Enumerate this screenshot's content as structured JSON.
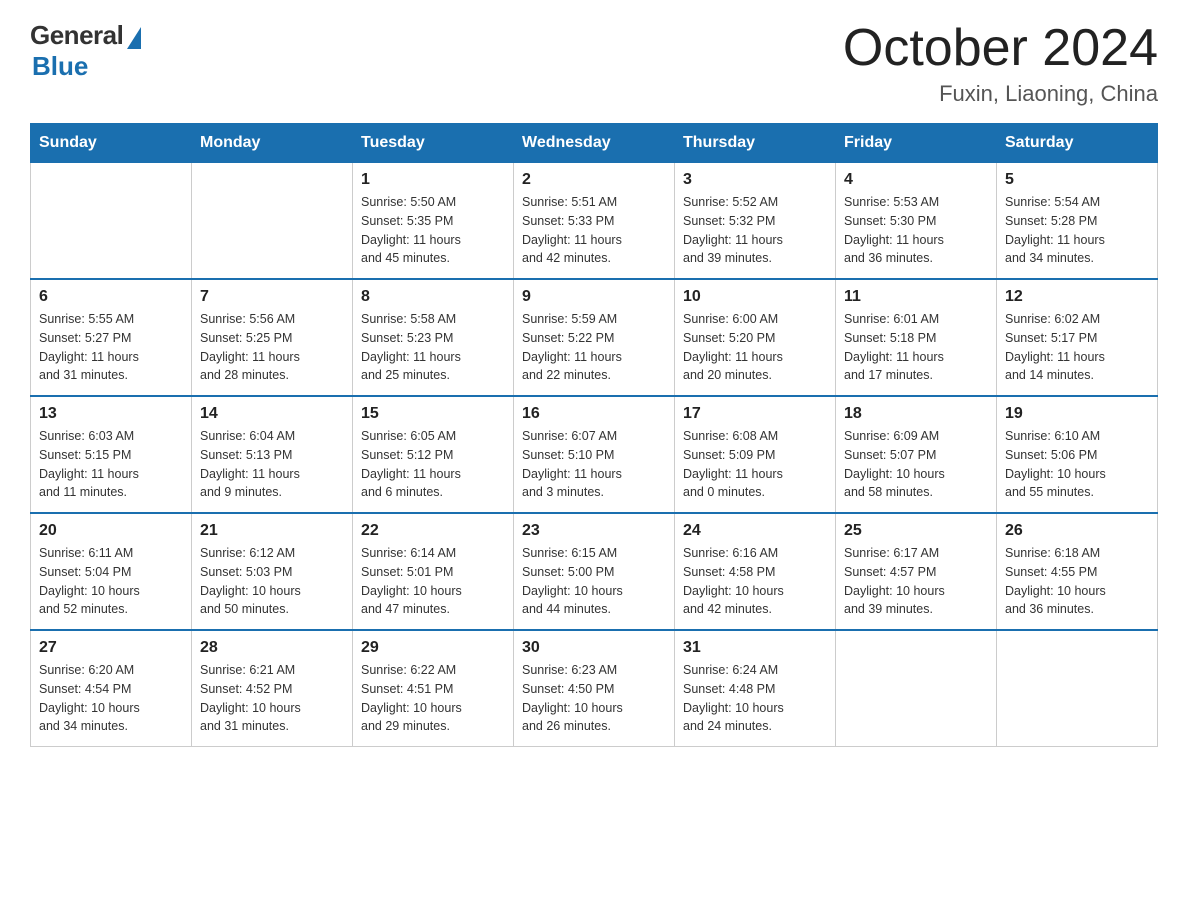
{
  "header": {
    "logo_general": "General",
    "logo_blue": "Blue",
    "month_year": "October 2024",
    "location": "Fuxin, Liaoning, China"
  },
  "columns": [
    "Sunday",
    "Monday",
    "Tuesday",
    "Wednesday",
    "Thursday",
    "Friday",
    "Saturday"
  ],
  "weeks": [
    [
      {
        "day": "",
        "info": ""
      },
      {
        "day": "",
        "info": ""
      },
      {
        "day": "1",
        "info": "Sunrise: 5:50 AM\nSunset: 5:35 PM\nDaylight: 11 hours\nand 45 minutes."
      },
      {
        "day": "2",
        "info": "Sunrise: 5:51 AM\nSunset: 5:33 PM\nDaylight: 11 hours\nand 42 minutes."
      },
      {
        "day": "3",
        "info": "Sunrise: 5:52 AM\nSunset: 5:32 PM\nDaylight: 11 hours\nand 39 minutes."
      },
      {
        "day": "4",
        "info": "Sunrise: 5:53 AM\nSunset: 5:30 PM\nDaylight: 11 hours\nand 36 minutes."
      },
      {
        "day": "5",
        "info": "Sunrise: 5:54 AM\nSunset: 5:28 PM\nDaylight: 11 hours\nand 34 minutes."
      }
    ],
    [
      {
        "day": "6",
        "info": "Sunrise: 5:55 AM\nSunset: 5:27 PM\nDaylight: 11 hours\nand 31 minutes."
      },
      {
        "day": "7",
        "info": "Sunrise: 5:56 AM\nSunset: 5:25 PM\nDaylight: 11 hours\nand 28 minutes."
      },
      {
        "day": "8",
        "info": "Sunrise: 5:58 AM\nSunset: 5:23 PM\nDaylight: 11 hours\nand 25 minutes."
      },
      {
        "day": "9",
        "info": "Sunrise: 5:59 AM\nSunset: 5:22 PM\nDaylight: 11 hours\nand 22 minutes."
      },
      {
        "day": "10",
        "info": "Sunrise: 6:00 AM\nSunset: 5:20 PM\nDaylight: 11 hours\nand 20 minutes."
      },
      {
        "day": "11",
        "info": "Sunrise: 6:01 AM\nSunset: 5:18 PM\nDaylight: 11 hours\nand 17 minutes."
      },
      {
        "day": "12",
        "info": "Sunrise: 6:02 AM\nSunset: 5:17 PM\nDaylight: 11 hours\nand 14 minutes."
      }
    ],
    [
      {
        "day": "13",
        "info": "Sunrise: 6:03 AM\nSunset: 5:15 PM\nDaylight: 11 hours\nand 11 minutes."
      },
      {
        "day": "14",
        "info": "Sunrise: 6:04 AM\nSunset: 5:13 PM\nDaylight: 11 hours\nand 9 minutes."
      },
      {
        "day": "15",
        "info": "Sunrise: 6:05 AM\nSunset: 5:12 PM\nDaylight: 11 hours\nand 6 minutes."
      },
      {
        "day": "16",
        "info": "Sunrise: 6:07 AM\nSunset: 5:10 PM\nDaylight: 11 hours\nand 3 minutes."
      },
      {
        "day": "17",
        "info": "Sunrise: 6:08 AM\nSunset: 5:09 PM\nDaylight: 11 hours\nand 0 minutes."
      },
      {
        "day": "18",
        "info": "Sunrise: 6:09 AM\nSunset: 5:07 PM\nDaylight: 10 hours\nand 58 minutes."
      },
      {
        "day": "19",
        "info": "Sunrise: 6:10 AM\nSunset: 5:06 PM\nDaylight: 10 hours\nand 55 minutes."
      }
    ],
    [
      {
        "day": "20",
        "info": "Sunrise: 6:11 AM\nSunset: 5:04 PM\nDaylight: 10 hours\nand 52 minutes."
      },
      {
        "day": "21",
        "info": "Sunrise: 6:12 AM\nSunset: 5:03 PM\nDaylight: 10 hours\nand 50 minutes."
      },
      {
        "day": "22",
        "info": "Sunrise: 6:14 AM\nSunset: 5:01 PM\nDaylight: 10 hours\nand 47 minutes."
      },
      {
        "day": "23",
        "info": "Sunrise: 6:15 AM\nSunset: 5:00 PM\nDaylight: 10 hours\nand 44 minutes."
      },
      {
        "day": "24",
        "info": "Sunrise: 6:16 AM\nSunset: 4:58 PM\nDaylight: 10 hours\nand 42 minutes."
      },
      {
        "day": "25",
        "info": "Sunrise: 6:17 AM\nSunset: 4:57 PM\nDaylight: 10 hours\nand 39 minutes."
      },
      {
        "day": "26",
        "info": "Sunrise: 6:18 AM\nSunset: 4:55 PM\nDaylight: 10 hours\nand 36 minutes."
      }
    ],
    [
      {
        "day": "27",
        "info": "Sunrise: 6:20 AM\nSunset: 4:54 PM\nDaylight: 10 hours\nand 34 minutes."
      },
      {
        "day": "28",
        "info": "Sunrise: 6:21 AM\nSunset: 4:52 PM\nDaylight: 10 hours\nand 31 minutes."
      },
      {
        "day": "29",
        "info": "Sunrise: 6:22 AM\nSunset: 4:51 PM\nDaylight: 10 hours\nand 29 minutes."
      },
      {
        "day": "30",
        "info": "Sunrise: 6:23 AM\nSunset: 4:50 PM\nDaylight: 10 hours\nand 26 minutes."
      },
      {
        "day": "31",
        "info": "Sunrise: 6:24 AM\nSunset: 4:48 PM\nDaylight: 10 hours\nand 24 minutes."
      },
      {
        "day": "",
        "info": ""
      },
      {
        "day": "",
        "info": ""
      }
    ]
  ]
}
